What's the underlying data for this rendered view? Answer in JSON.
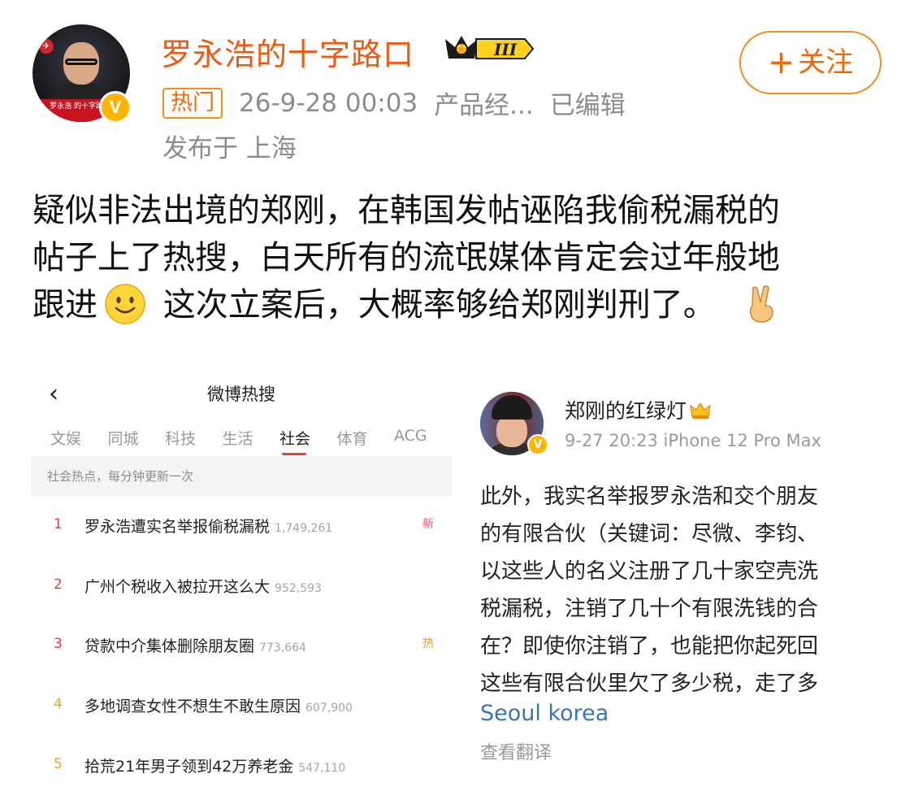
{
  "post": {
    "author": "罗永浩的十字路口",
    "crown_level": "III",
    "avatar_text": "罗永浩\n的十字路口",
    "verified_mark": "V",
    "follow_plus": "+",
    "follow_label": "关注",
    "hot_tag": "热门",
    "timestamp": "26-9-28 00:03",
    "source": "产品经...",
    "edited": "已编辑",
    "location": "发布于 上海",
    "text_lines": [
      "疑似非法出境的郑刚，在韩国发帖诬陷我偷税漏税的",
      "帖子上了热搜，白天所有的流氓媒体肯定会过年般地",
      "跟进",
      " 这次立案后，大概率够给郑刚判刑了。"
    ]
  },
  "hot_search": {
    "back_icon": "‹",
    "title": "微博热搜",
    "tabs": [
      "文娱",
      "同城",
      "科技",
      "生活",
      "社会",
      "体育",
      "ACG"
    ],
    "active_tab": "社会",
    "banner": "社会热点，每分钟更新一次",
    "items": [
      {
        "rank": "1",
        "text": "罗永浩遭实名举报偷税漏税",
        "count": "1,749,261",
        "badge": "新"
      },
      {
        "rank": "2",
        "text": "广州个税收入被拉开这么大",
        "count": "952,593",
        "badge": ""
      },
      {
        "rank": "3",
        "text": "贷款中介集体删除朋友圈",
        "count": "773,664",
        "badge": "热"
      },
      {
        "rank": "4",
        "text": "多地调查女性不想生不敢生原因",
        "count": "607,900",
        "badge": ""
      },
      {
        "rank": "5",
        "text": "拾荒21年男子领到42万养老金",
        "count": "547,110",
        "badge": ""
      }
    ]
  },
  "quoted_post": {
    "author": "郑刚的红绿灯",
    "verified_mark": "V",
    "time_device": "9-27 20:23  iPhone 12 Pro Max",
    "lines": [
      "此外，我实名举报罗永浩和交个朋友",
      "的有限合伙（关键词：尽微、李钧、",
      "以这些人的名义注册了几十家空壳洗",
      "税漏税，注销了几十个有限洗钱的合",
      "在？即使你注销了，也能把你起死回",
      "这些有限合伙里欠了多少税，走了多"
    ],
    "location": "Seoul korea",
    "translate": "查看翻译"
  },
  "colors": {
    "accent_orange": "#f05a10",
    "rank_red": "#e83a3a",
    "rank_orange": "#f5a020",
    "link_blue": "#3a74b8",
    "meta_gray": "#8c8c8c"
  }
}
